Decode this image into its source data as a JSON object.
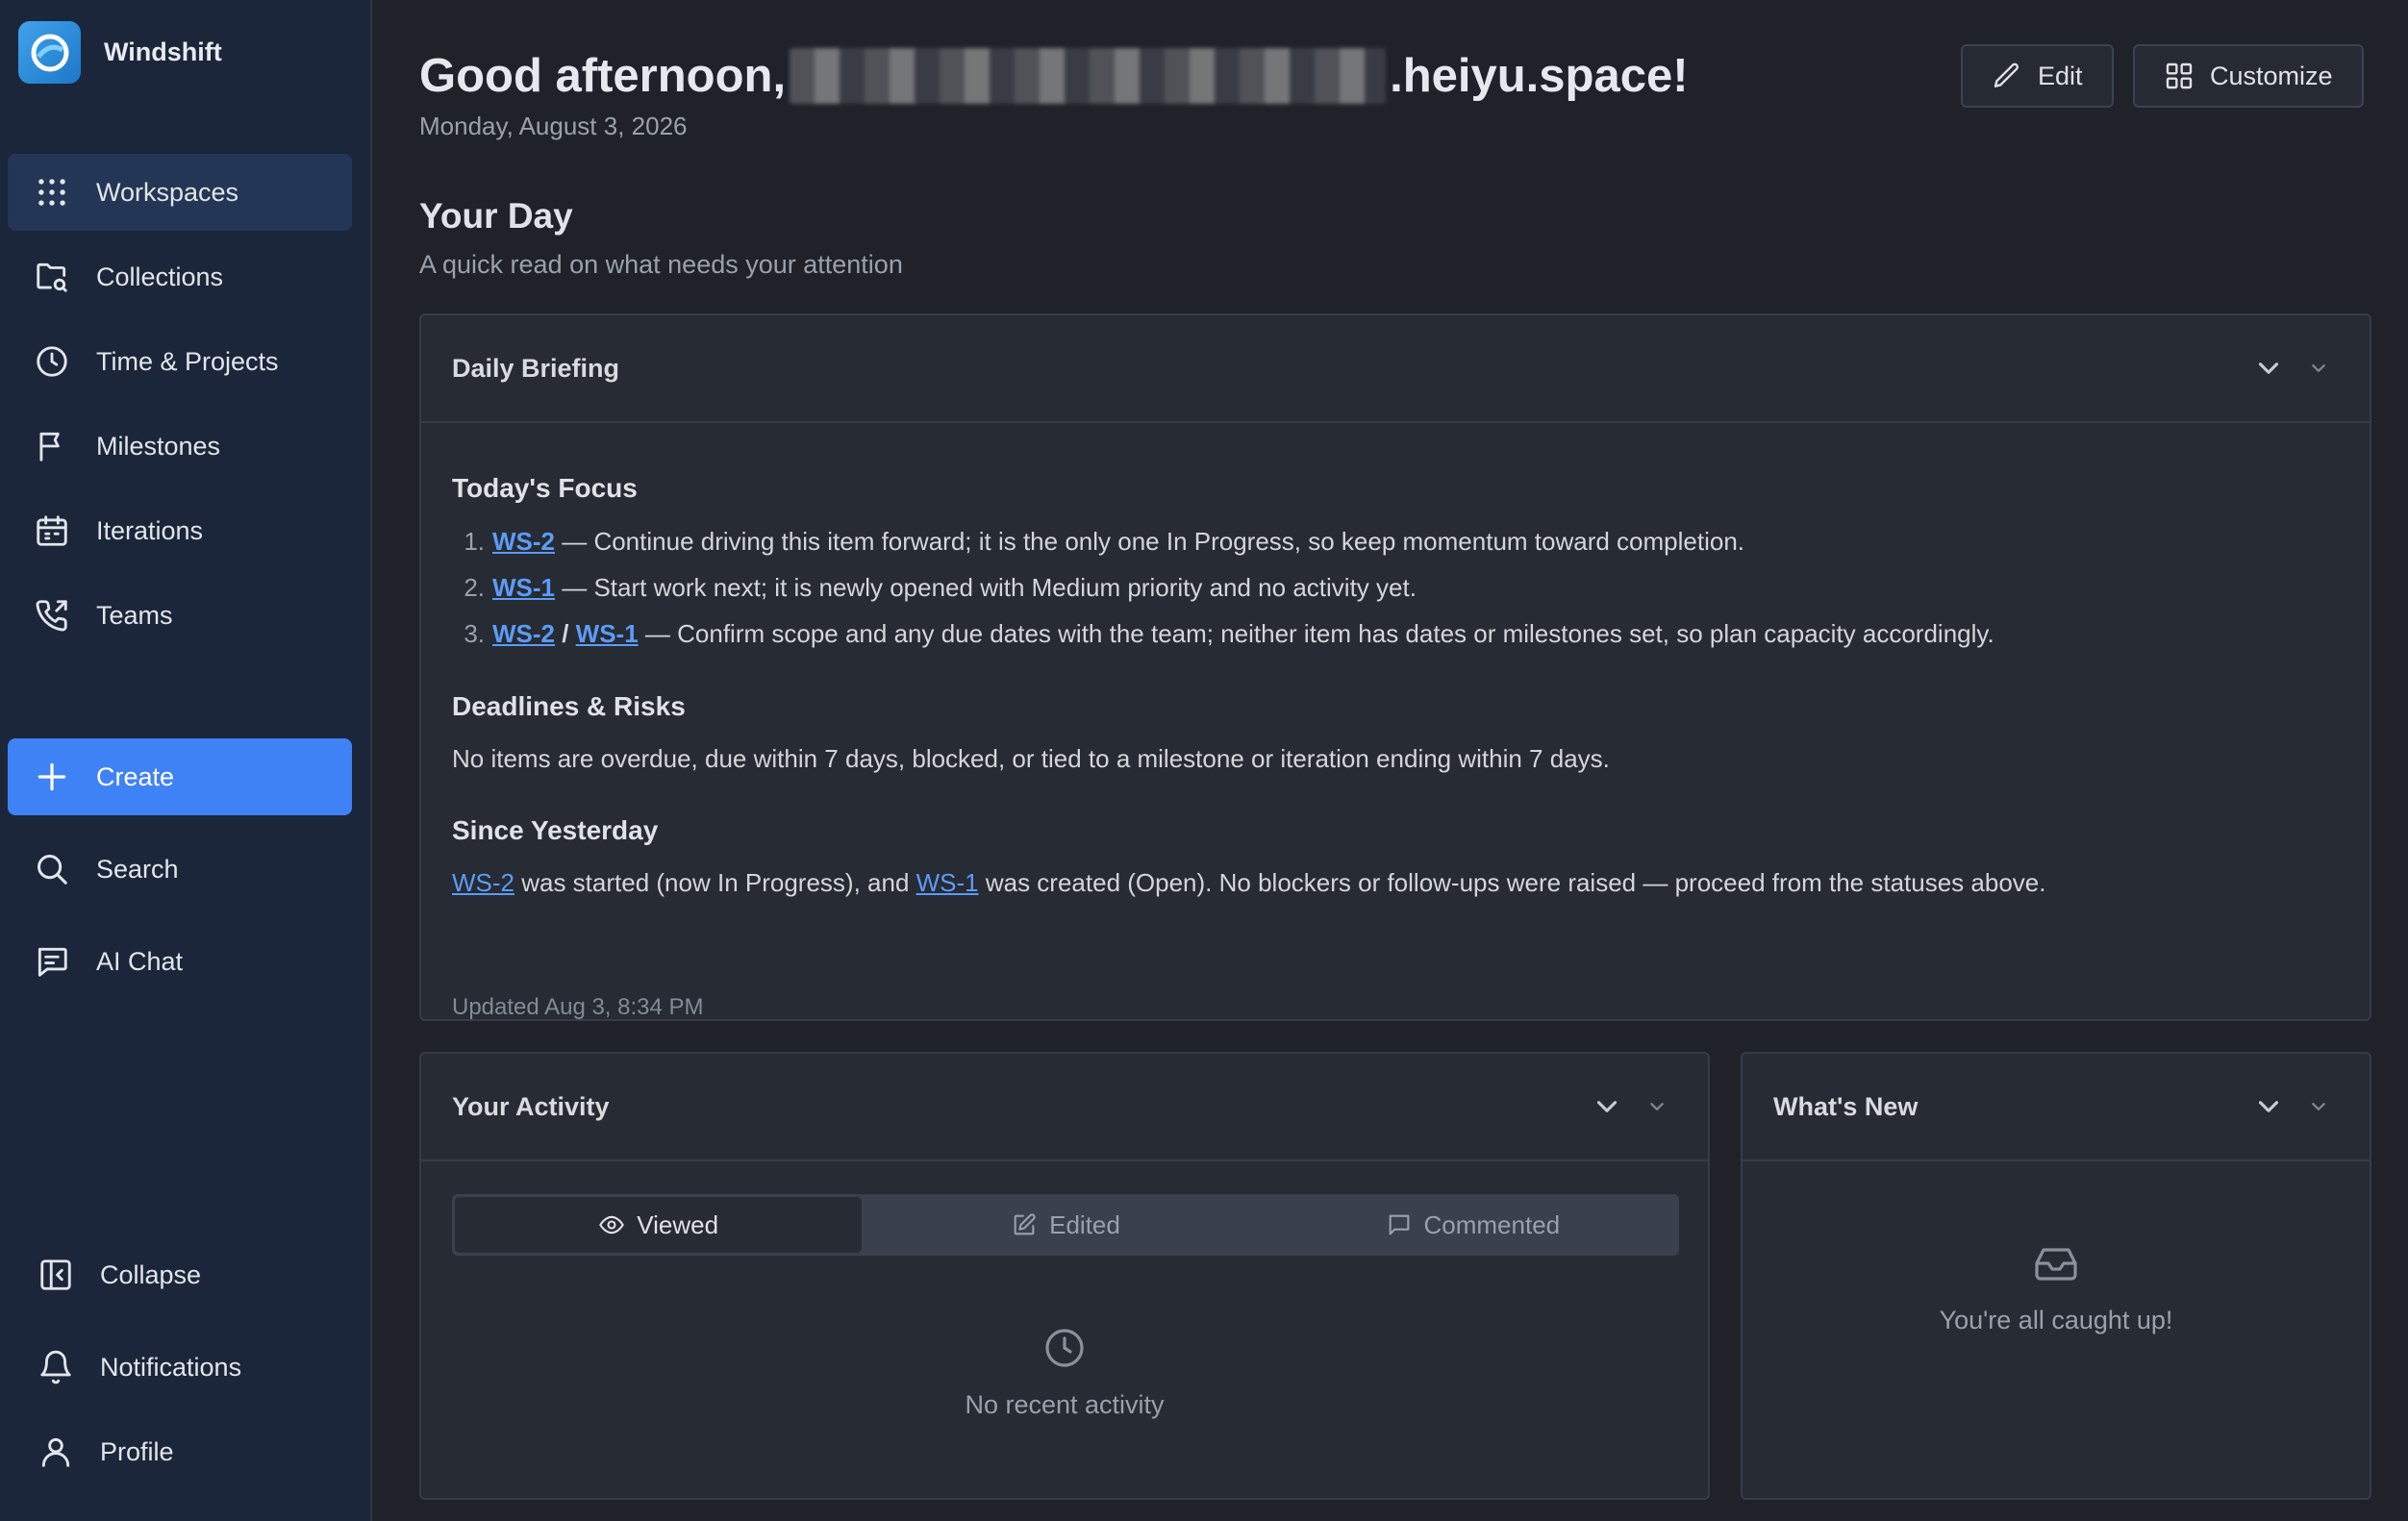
{
  "app": {
    "name": "Windshift"
  },
  "sidebar": {
    "items": [
      {
        "label": "Workspaces",
        "icon": "grid-icon"
      },
      {
        "label": "Collections",
        "icon": "folder-search-icon"
      },
      {
        "label": "Time & Projects",
        "icon": "clock-icon"
      },
      {
        "label": "Milestones",
        "icon": "flag-icon"
      },
      {
        "label": "Iterations",
        "icon": "calendar-icon"
      },
      {
        "label": "Teams",
        "icon": "phone-icon"
      }
    ],
    "create_label": "Create",
    "search_label": "Search",
    "ai_chat_label": "AI Chat",
    "collapse_label": "Collapse",
    "notifications_label": "Notifications",
    "profile_label": "Profile"
  },
  "header": {
    "greeting_prefix": "Good afternoon,",
    "greeting_suffix": ".heiyu.space!",
    "date": "Monday, August 3, 2026",
    "edit_label": "Edit",
    "customize_label": "Customize"
  },
  "your_day": {
    "title": "Your Day",
    "subtitle": "A quick read on what needs your attention"
  },
  "briefing": {
    "title": "Daily Briefing",
    "focus_heading": "Today's Focus",
    "focus_items": [
      {
        "num": "1.",
        "ref": "WS-2",
        "text": " — Continue driving this item forward; it is the only one In Progress, so keep momentum toward completion."
      },
      {
        "num": "2.",
        "ref": "WS-1",
        "text": " — Start work next; it is newly opened with Medium priority and no activity yet."
      },
      {
        "num": "3.",
        "ref": "WS-2",
        "sep": " / ",
        "ref2": "WS-1",
        "text": " — Confirm scope and any due dates with the team; neither item has dates or milestones set, so plan capacity accordingly."
      }
    ],
    "risks_heading": "Deadlines & Risks",
    "risks_text": "No items are overdue, due within 7 days, blocked, or tied to a milestone or iteration ending within 7 days.",
    "since_heading": "Since Yesterday",
    "since_ref1": "WS-2",
    "since_text1": " was started (now In Progress), and ",
    "since_ref2": "WS-1",
    "since_text2": " was created (Open). No blockers or follow-ups were raised — proceed from the statuses above.",
    "updated": "Updated Aug 3, 8:34 PM"
  },
  "activity": {
    "title": "Your Activity",
    "tabs": [
      {
        "label": "Viewed",
        "icon": "eye-icon"
      },
      {
        "label": "Edited",
        "icon": "edit-icon"
      },
      {
        "label": "Commented",
        "icon": "comment-icon"
      }
    ],
    "empty_text": "No recent activity"
  },
  "whats_new": {
    "title": "What's New",
    "empty_text": "You're all caught up!"
  },
  "colors": {
    "accent": "#3f82f5",
    "link": "#5c9cf5",
    "sidebar_bg": "#1b263a",
    "main_bg": "#1f2229",
    "card_bg": "#272b33"
  }
}
